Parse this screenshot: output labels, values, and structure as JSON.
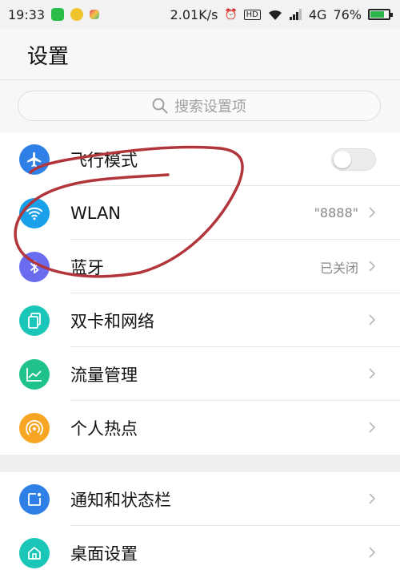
{
  "status_bar": {
    "time": "19:33",
    "speed": "2.01K/s",
    "hd": "HD",
    "network": "4G",
    "battery": "76%",
    "battery_level": 0.76
  },
  "header": {
    "title": "设置"
  },
  "search": {
    "placeholder": "搜索设置项"
  },
  "groups": [
    {
      "items": [
        {
          "label": "飞行模式",
          "icon": "airplane-icon",
          "color": "#2f80e6",
          "toggle": "off"
        },
        {
          "label": "WLAN",
          "icon": "wifi-icon",
          "color": "#1aa0e8",
          "value": "\"8888\""
        },
        {
          "label": "蓝牙",
          "icon": "bluetooth-icon",
          "color": "#6a6cf0",
          "value": "已关闭"
        },
        {
          "label": "双卡和网络",
          "icon": "sim-card-icon",
          "color": "#19c6b7"
        },
        {
          "label": "流量管理",
          "icon": "data-usage-icon",
          "color": "#1fc28c"
        },
        {
          "label": "个人热点",
          "icon": "hotspot-icon",
          "color": "#f6a623"
        }
      ]
    },
    {
      "items": [
        {
          "label": "通知和状态栏",
          "icon": "notification-icon",
          "color": "#2f80e6"
        },
        {
          "label": "桌面设置",
          "icon": "home-icon",
          "color": "#19c6b7"
        }
      ]
    }
  ],
  "colors": {
    "annotation_stroke": "#b2353b",
    "chevron": "#b8b8b8",
    "divider": "#e6e6e6"
  }
}
